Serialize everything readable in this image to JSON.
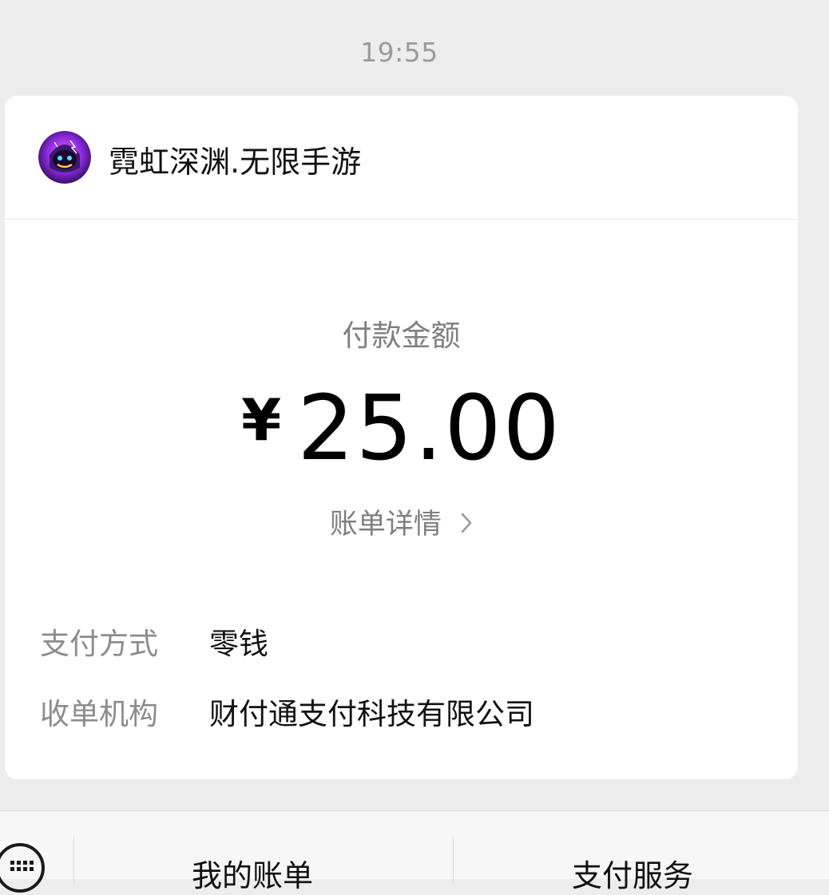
{
  "chat": {
    "timestamp": "19:55"
  },
  "payment_card": {
    "merchant_name": "霓虹深渊.无限手游",
    "avatar": "game-character-avatar",
    "amount_label": "付款金额",
    "currency_symbol": "¥",
    "amount_value": "25.00",
    "bill_details_label": "账单详情",
    "rows": [
      {
        "label": "支付方式",
        "value": "零钱"
      },
      {
        "label": "收单机构",
        "value": "财付通支付科技有限公司"
      }
    ]
  },
  "bottom_menu": {
    "keyboard_icon": "keyboard-icon",
    "items": [
      {
        "label": "我的账单"
      },
      {
        "label": "支付服务"
      }
    ]
  }
}
